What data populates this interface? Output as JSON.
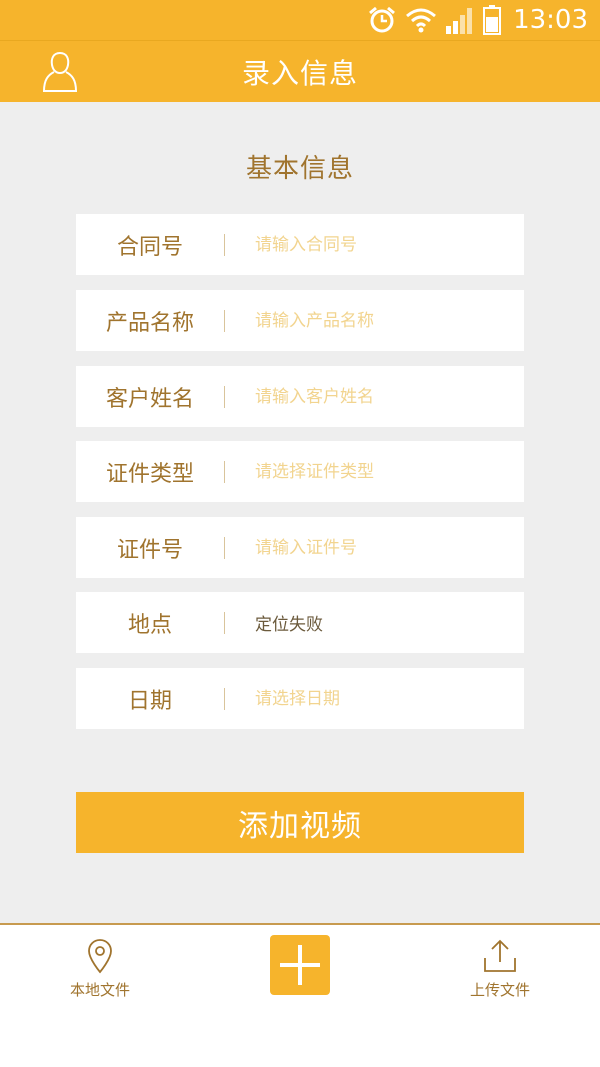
{
  "status_bar": {
    "time": "13:03"
  },
  "header": {
    "title": "录入信息"
  },
  "section": {
    "title": "基本信息"
  },
  "form": {
    "fields": [
      {
        "label": "合同号",
        "placeholder": "请输入合同号",
        "value": ""
      },
      {
        "label": "产品名称",
        "placeholder": "请输入产品名称",
        "value": ""
      },
      {
        "label": "客户姓名",
        "placeholder": "请输入客户姓名",
        "value": ""
      },
      {
        "label": "证件类型",
        "placeholder": "请选择证件类型",
        "value": ""
      },
      {
        "label": "证件号",
        "placeholder": "请输入证件号",
        "value": ""
      },
      {
        "label": "地点",
        "placeholder": "",
        "value": "定位失败"
      },
      {
        "label": "日期",
        "placeholder": "请选择日期",
        "value": ""
      }
    ]
  },
  "add_video": {
    "label": "添加视频"
  },
  "bottom_nav": {
    "local_files": {
      "label": "本地文件",
      "icon": "location-pin-icon"
    },
    "add": {
      "icon": "plus-icon"
    },
    "upload_files": {
      "label": "上传文件",
      "icon": "upload-icon"
    }
  },
  "colors": {
    "accent": "#f6b42c",
    "label": "#a0742e",
    "placeholder": "#f2d48f",
    "background": "#eeeeee"
  }
}
